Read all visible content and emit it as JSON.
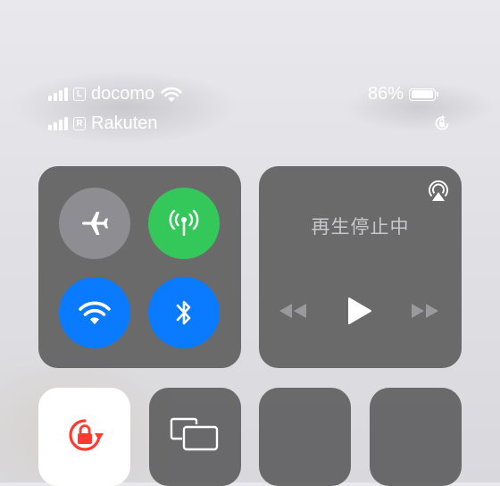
{
  "status_bar": {
    "line1": {
      "carrier": "docomo",
      "sim_badge": "L",
      "signal_bars": 4
    },
    "line2": {
      "carrier": "Rakuten",
      "sim_badge": "R",
      "signal_bars": 4
    },
    "battery_percent": "86%",
    "battery_level": 0.86,
    "orientation_lock_icon": "rotation-lock-icon"
  },
  "connectivity": {
    "airplane": {
      "icon": "airplane-icon",
      "active": false,
      "color": "#8e8e92"
    },
    "cellular": {
      "icon": "antenna-icon",
      "active": true,
      "color": "#34c759"
    },
    "wifi": {
      "icon": "wifi-icon",
      "active": true,
      "color": "#0a7aff"
    },
    "bluetooth": {
      "icon": "bluetooth-icon",
      "active": true,
      "color": "#0a7aff"
    }
  },
  "now_playing": {
    "status_text": "再生停止中",
    "airplay_icon": "airplay-icon",
    "controls": [
      "rewind-icon",
      "play-icon",
      "fast-forward-icon"
    ]
  },
  "bottom_tiles": {
    "orientation_lock": {
      "icon": "rotation-lock-icon",
      "active": true,
      "accent": "#ff3b30"
    },
    "screen_mirroring": {
      "icon": "screen-mirroring-icon"
    }
  }
}
